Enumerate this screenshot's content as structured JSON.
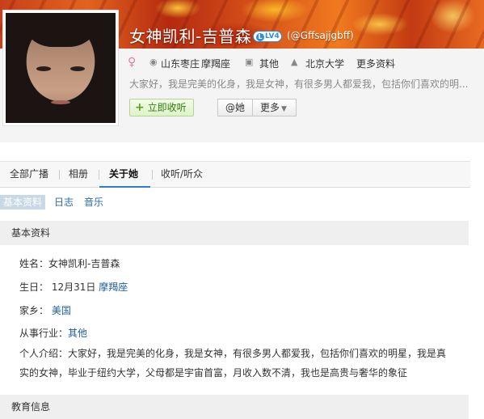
{
  "profile": {
    "name": "女神凯利-吉普森",
    "level_badge": "LV4",
    "handle": "(@Gffsajjgbff)",
    "location": "山东枣庄",
    "zodiac": "摩羯座",
    "occupation": "其他",
    "school": "北京大学",
    "more_info": "更多资料",
    "intro": "大家好，我是完美的化身，我是女神，有很多男人都爱我，包括你们喜欢的明..."
  },
  "actions": {
    "follow": "立即收听",
    "at": "@她",
    "more": "更多"
  },
  "tabs": [
    {
      "label": "全部广播"
    },
    {
      "label": "相册"
    },
    {
      "label": "关于她"
    },
    {
      "label": "收听/听众"
    }
  ],
  "subtabs": [
    {
      "label": "基本资料"
    },
    {
      "label": "日志"
    },
    {
      "label": "音乐"
    }
  ],
  "basic": {
    "heading": "基本资料",
    "name_label": "姓名：",
    "name_value": "女神凯利-吉普森",
    "birthday_label": "生日：",
    "birthday_value": "12月31日",
    "birthday_zodiac": "摩羯座",
    "hometown_label": "家乡：",
    "hometown_value": "美国",
    "industry_label": "从事行业：",
    "industry_value": "其他",
    "intro_label": "个人介绍：",
    "intro_value": "大家好，我是完美的化身，我是女神，有很多男人都爱我，包括你们喜欢的明星，我是真实的女神，毕业于纽约大学，父母都是宇宙首富，月收入数不清，我也是高贵与奢华的象征"
  },
  "education": {
    "heading": "教育信息"
  },
  "colors": {
    "accent": "#2a7fc7",
    "link": "#1f5c99",
    "follow_green": "#2f7d10"
  }
}
